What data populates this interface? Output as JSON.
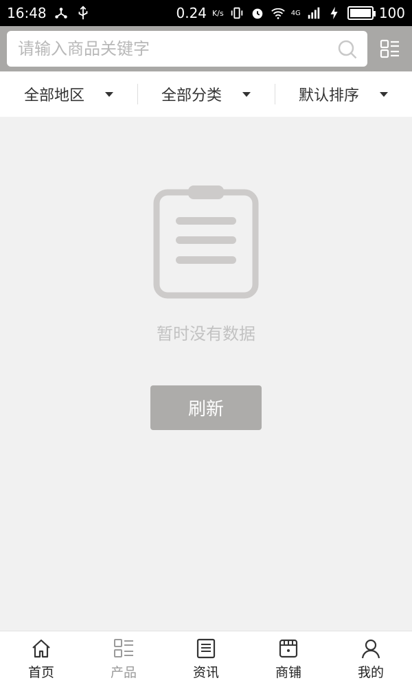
{
  "status_bar": {
    "time": "16:48",
    "speed": "0.24",
    "speed_unit": "K/s",
    "network": "4G",
    "battery": "100"
  },
  "search": {
    "placeholder": "请输入商品关键字"
  },
  "filters": [
    {
      "label": "全部地区"
    },
    {
      "label": "全部分类"
    },
    {
      "label": "默认排序"
    }
  ],
  "empty_state": {
    "message": "暂时没有数据",
    "refresh_label": "刷新"
  },
  "bottom_nav": [
    {
      "label": "首页",
      "icon": "home-icon"
    },
    {
      "label": "产品",
      "icon": "product-list-icon"
    },
    {
      "label": "资讯",
      "icon": "news-icon"
    },
    {
      "label": "商铺",
      "icon": "shop-icon"
    },
    {
      "label": "我的",
      "icon": "profile-icon"
    }
  ],
  "colors": {
    "header_bg": "#a9a8a6",
    "page_bg": "#f1f1f1",
    "button_bg": "#adacaa",
    "icon_gray": "#cdcbca"
  }
}
